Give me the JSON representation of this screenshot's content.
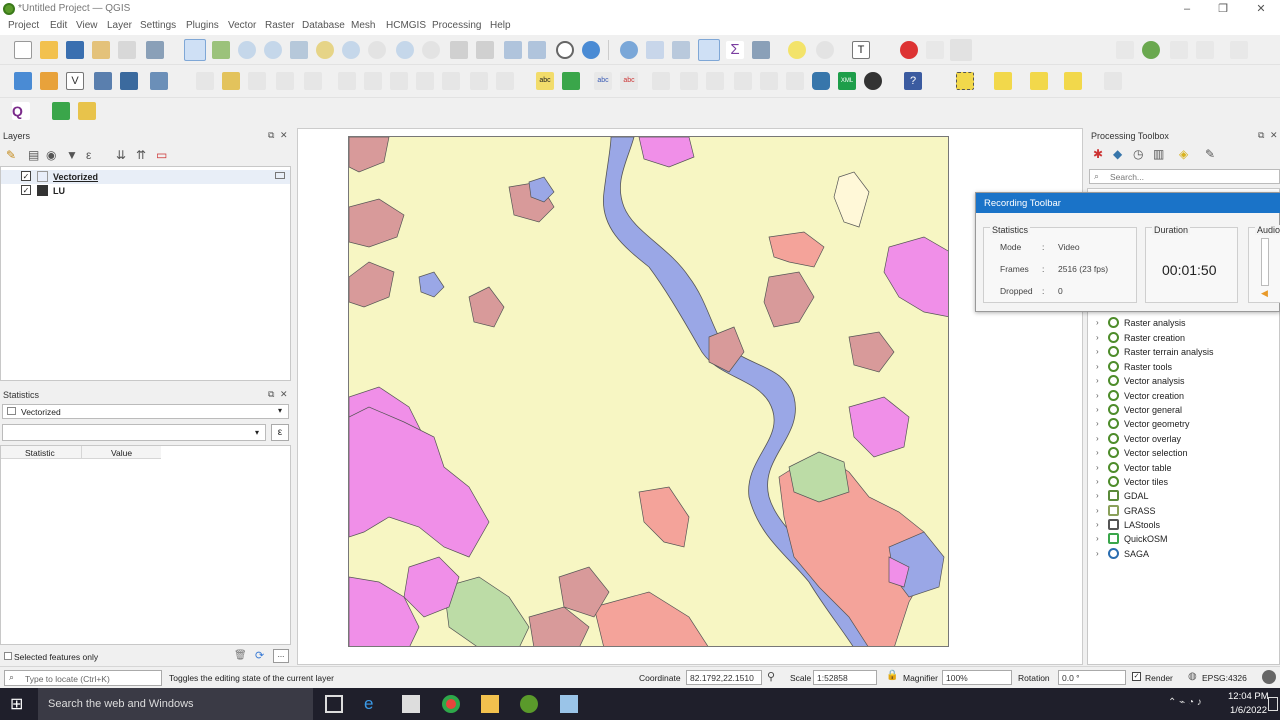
{
  "window": {
    "title": "*Untitled Project — QGIS"
  },
  "menu": [
    "Project",
    "Edit",
    "View",
    "Layer",
    "Settings",
    "Plugins",
    "Vector",
    "Raster",
    "Database",
    "Mesh",
    "HCMGIS",
    "Processing",
    "Help"
  ],
  "toolbar": {
    "font_size_value": "12",
    "font_unit": "px"
  },
  "layers_panel": {
    "title": "Layers",
    "items": [
      {
        "name": "Vectorized",
        "checked": true
      },
      {
        "name": "LU",
        "checked": true
      }
    ]
  },
  "statistics_panel": {
    "title": "Statistics",
    "layer": "Vectorized",
    "col_statistic": "Statistic",
    "col_value": "Value",
    "selected_only": "Selected features only"
  },
  "processing": {
    "title": "Processing Toolbox",
    "search_placeholder": "Search...",
    "items": [
      "Raster analysis",
      "Raster creation",
      "Raster terrain analysis",
      "Raster tools",
      "Vector analysis",
      "Vector creation",
      "Vector general",
      "Vector geometry",
      "Vector overlay",
      "Vector selection",
      "Vector table",
      "Vector tiles",
      "GDAL",
      "GRASS",
      "LAStools",
      "QuickOSM",
      "SAGA"
    ]
  },
  "recording": {
    "title": "Recording Toolbar",
    "stats_label": "Statistics",
    "mode_label": "Mode",
    "mode_value": "Video",
    "frames_label": "Frames",
    "frames_value": "2516 (23 fps)",
    "dropped_label": "Dropped",
    "dropped_value": "0",
    "colon": ":",
    "duration_label": "Duration",
    "duration_value": "00:01:50",
    "audio_label": "Audio"
  },
  "status": {
    "locate_placeholder": "Type to locate (Ctrl+K)",
    "message": "Toggles the editing state of the current layer",
    "coordinate_label": "Coordinate",
    "coordinate_value": "82.1792,22.1510",
    "scale_label": "Scale",
    "scale_value": "1:52858",
    "magnifier_label": "Magnifier",
    "magnifier_value": "100%",
    "rotation_label": "Rotation",
    "rotation_value": "0.0 °",
    "render_label": "Render",
    "crs": "EPSG:4326"
  },
  "taskbar": {
    "search": "Search the web and Windows",
    "time": "12:04 PM",
    "date": "1/6/2022"
  },
  "colors": {
    "map_bg": "#f7f6c3",
    "river": "#9aa7e6",
    "pink": "#f08fe8",
    "rose": "#d89a9a",
    "salmon": "#f4a39a",
    "green": "#bcdca6",
    "accent": "#1a73c8"
  }
}
